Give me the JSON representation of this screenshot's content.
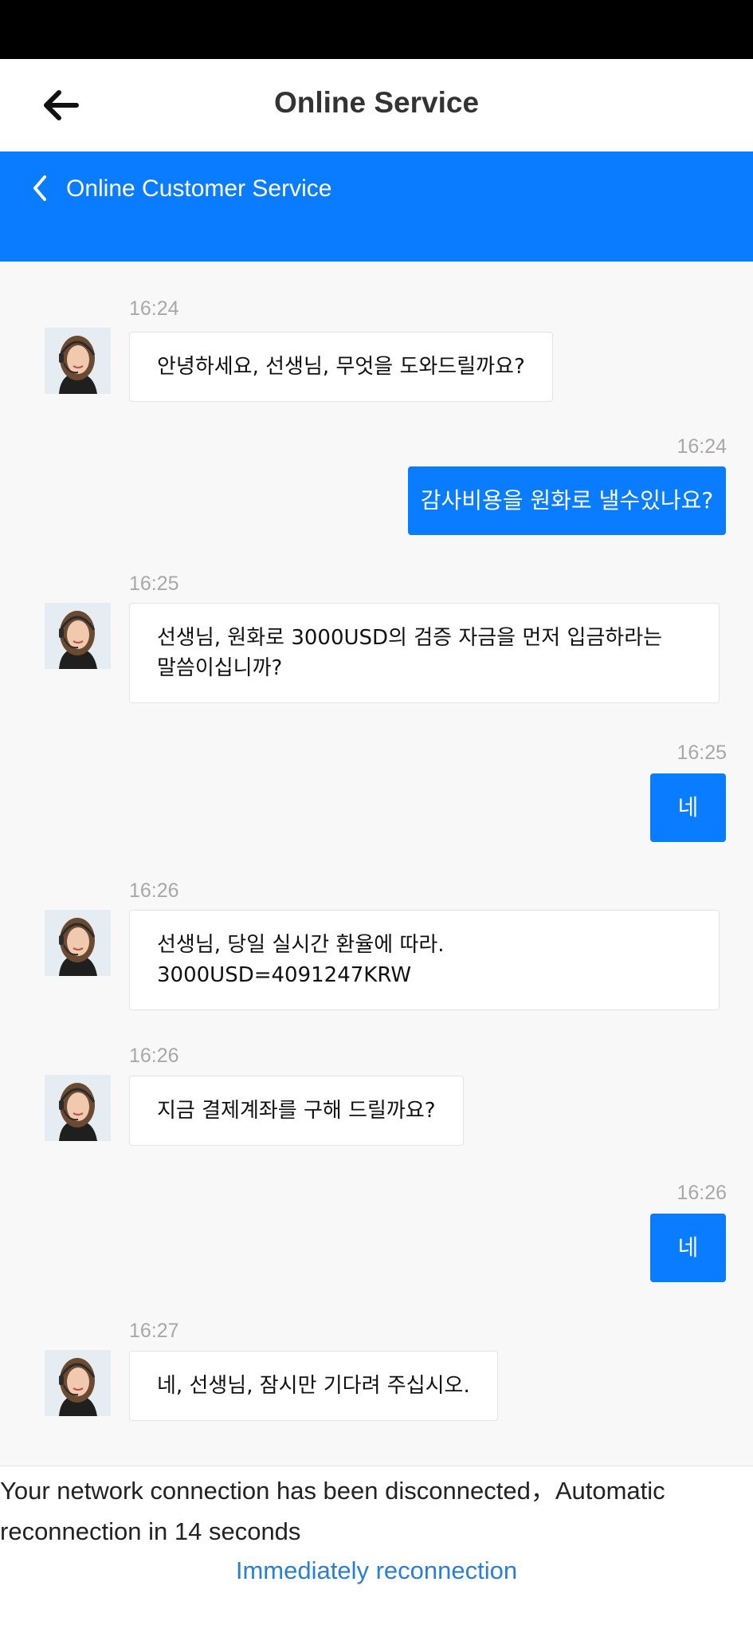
{
  "app": {
    "title": "Online Service"
  },
  "banner": {
    "title": "Online Customer Service"
  },
  "messages": [
    {
      "from": "agent",
      "time": "16:24",
      "text": "안녕하세요, 선생님, 무엇을 도와드릴까요?"
    },
    {
      "from": "user",
      "time": "16:24",
      "text": "감사비용을 원화로 낼수있나요?"
    },
    {
      "from": "agent",
      "time": "16:25",
      "text": "선생님, 원화로 3000USD의 검증 자금을 먼저 입금하라는",
      "text2": "말씀이십니까?"
    },
    {
      "from": "user",
      "time": "16:25",
      "text": "네"
    },
    {
      "from": "agent",
      "time": "16:26",
      "text": "선생님, 당일 실시간 환율에 따라.",
      "text2": "3000USD=4091247KRW"
    },
    {
      "from": "agent",
      "time": "16:26",
      "text": "지금 결제계좌를 구해 드릴까요?"
    },
    {
      "from": "user",
      "time": "16:26",
      "text": "네"
    },
    {
      "from": "agent",
      "time": "16:27",
      "text": "네, 선생님, 잠시만 기다려 주십시오."
    }
  ],
  "notice": {
    "text": "Your network connection has been disconnected，Automatic reconnection in 14 seconds"
  },
  "reconnect": {
    "label": "Immediately reconnection"
  },
  "colors": {
    "accent": "#0a7cff",
    "link": "#2a7fd4",
    "timestamp": "#a8a8a8"
  },
  "icons": {
    "back": "arrow-left-icon",
    "banner_back": "chevron-left-icon",
    "avatar": "agent-avatar"
  }
}
